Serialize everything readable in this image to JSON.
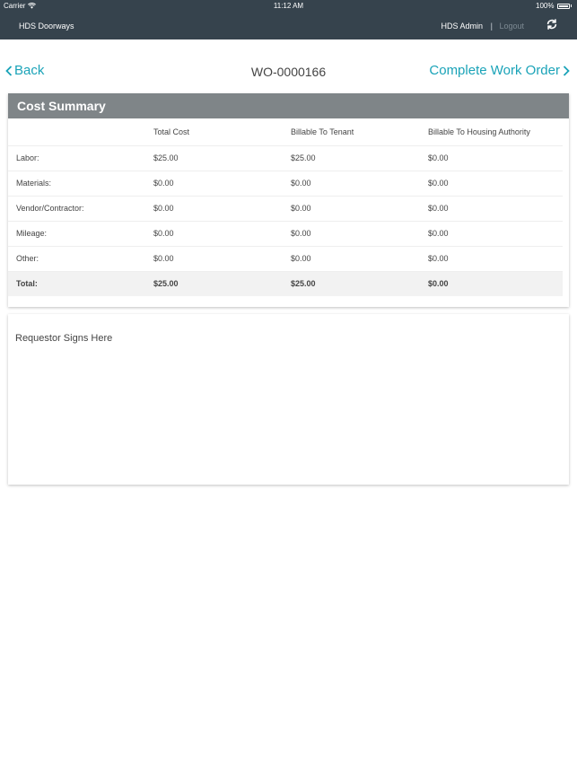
{
  "status_bar": {
    "carrier": "Carrier",
    "time": "11:12 AM",
    "battery": "100%"
  },
  "app_bar": {
    "title": "HDS Doorways",
    "user": "HDS Admin",
    "separator": "|",
    "logout": "Logout"
  },
  "nav": {
    "back": "Back",
    "work_order": "WO-0000166",
    "complete": "Complete Work Order"
  },
  "cost_summary": {
    "title": "Cost Summary",
    "headers": [
      "",
      "Total Cost",
      "Billable To Tenant",
      "Billable To Housing Authority"
    ],
    "rows": [
      [
        "Labor:",
        "$25.00",
        "$25.00",
        "$0.00"
      ],
      [
        "Materials:",
        "$0.00",
        "$0.00",
        "$0.00"
      ],
      [
        "Vendor/Contractor:",
        "$0.00",
        "$0.00",
        "$0.00"
      ],
      [
        "Mileage:",
        "$0.00",
        "$0.00",
        "$0.00"
      ],
      [
        "Other:",
        "$0.00",
        "$0.00",
        "$0.00"
      ]
    ],
    "total": [
      "Total:",
      "$25.00",
      "$25.00",
      "$0.00"
    ]
  },
  "signature": {
    "label": "Requestor Signs Here"
  },
  "colors": {
    "header_bar": "#36434d",
    "accent": "#1aa3b8",
    "card_header": "#7f8588"
  }
}
